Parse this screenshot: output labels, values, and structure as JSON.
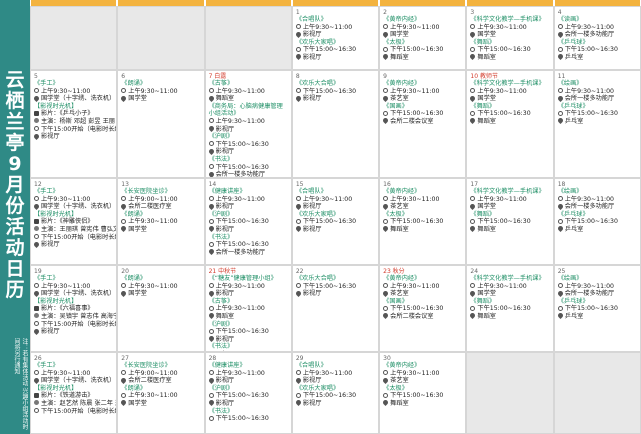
{
  "sidebar": {
    "title": "云栖兰亭9月份活动日历",
    "note": "注：若有集体活动 兴趣小组活动时间将另行通知"
  },
  "cells": [
    {
      "date": "",
      "events": [],
      "empty": true
    },
    {
      "date": "",
      "events": [],
      "empty": true
    },
    {
      "date": "",
      "events": [],
      "empty": true
    },
    {
      "date": "1",
      "events": [
        {
          "title": "《合唱队》",
          "rows": [
            {
              "icon": "clock",
              "text": "上午9:30~11:00"
            },
            {
              "icon": "pin",
              "text": "影视厅"
            }
          ]
        },
        {
          "title": "《欢乐大家唱》",
          "rows": [
            {
              "icon": "clock",
              "text": "下午15:00~16:30"
            },
            {
              "icon": "pin",
              "text": "影视厅"
            }
          ]
        }
      ]
    },
    {
      "date": "2",
      "events": [
        {
          "title": "《黄帝内经》",
          "rows": [
            {
              "icon": "clock",
              "text": "上午9:30~11:00"
            },
            {
              "icon": "pin",
              "text": "国学堂"
            }
          ]
        },
        {
          "title": "《太极》",
          "rows": [
            {
              "icon": "clock",
              "text": "下午15:00~16:30"
            },
            {
              "icon": "pin",
              "text": "舞蹈室"
            }
          ]
        }
      ]
    },
    {
      "date": "3",
      "events": [
        {
          "title": "《科学文化教学—手机课》",
          "rows": [
            {
              "icon": "clock",
              "text": "上午9:30~11:00"
            },
            {
              "icon": "pin",
              "text": "国学堂"
            }
          ]
        },
        {
          "title": "《舞蹈》",
          "rows": [
            {
              "icon": "clock",
              "text": "下午15:00~16:30"
            },
            {
              "icon": "pin",
              "text": "舞蹈室"
            }
          ]
        }
      ]
    },
    {
      "date": "4",
      "events": [
        {
          "title": "《读画》",
          "rows": [
            {
              "icon": "clock",
              "text": "上午9:30~11:00"
            },
            {
              "icon": "pin",
              "text": "会所一楼多功能厅"
            }
          ]
        },
        {
          "title": "《乒乓球》",
          "rows": [
            {
              "icon": "clock",
              "text": "下午15:00~16:30"
            },
            {
              "icon": "pin",
              "text": "乒乓室"
            }
          ]
        }
      ]
    },
    {
      "date": "5",
      "events": [
        {
          "title": "《手工》",
          "rows": [
            {
              "icon": "clock",
              "text": "上午9:30~11:00"
            },
            {
              "icon": "pin",
              "text": "国学堂（十字绣、洗衣机）"
            }
          ]
        },
        {
          "title": "【影视时光机】",
          "rows": [
            {
              "icon": "film",
              "text": "影片：《乒乓小子》"
            },
            {
              "icon": "person",
              "text": "主演：杨斯 邓超 彭昱 王丽"
            },
            {
              "icon": "clock",
              "text": "下午15:00开始（电影时长约120分钟）"
            },
            {
              "icon": "pin",
              "text": "影视厅"
            }
          ]
        }
      ]
    },
    {
      "date": "6",
      "events": [
        {
          "title": "《朗诵》",
          "rows": [
            {
              "icon": "clock",
              "text": "上午9:30~11:00"
            },
            {
              "icon": "pin",
              "text": "国学堂"
            }
          ]
        }
      ]
    },
    {
      "date": "7",
      "red": "白露",
      "events": [
        {
          "title": "《古筝》",
          "rows": [
            {
              "icon": "clock",
              "text": "上午9:30~11:00"
            },
            {
              "icon": "pin",
              "text": "舞蹈室"
            }
          ]
        },
        {
          "title": "《商务局：心脑病健康管理小组活动》",
          "rows": [
            {
              "icon": "clock",
              "text": "上午9:30~11:00"
            },
            {
              "icon": "pin",
              "text": "影视厅"
            }
          ]
        },
        {
          "title": "《沪剧》",
          "rows": [
            {
              "icon": "clock",
              "text": "下午15:00~16:30"
            },
            {
              "icon": "pin",
              "text": "影视厅"
            }
          ]
        },
        {
          "title": "《书法》",
          "rows": [
            {
              "icon": "clock",
              "text": "下午15:00~16:30"
            },
            {
              "icon": "pin",
              "text": "会所一楼多功能厅"
            }
          ]
        }
      ]
    },
    {
      "date": "8",
      "events": [
        {
          "title": "《欢乐大合唱》",
          "rows": [
            {
              "icon": "clock",
              "text": "下午15:00~16:30"
            },
            {
              "icon": "pin",
              "text": "影视厅"
            }
          ]
        }
      ]
    },
    {
      "date": "9",
      "events": [
        {
          "title": "《黄帝内经》",
          "rows": [
            {
              "icon": "clock",
              "text": "上午9:30~11:00"
            },
            {
              "icon": "pin",
              "text": "茶艺室"
            }
          ]
        },
        {
          "title": "《国画》",
          "rows": [
            {
              "icon": "clock",
              "text": "下午15:00~16:30"
            },
            {
              "icon": "pin",
              "text": "会所二楼会议室"
            }
          ]
        }
      ]
    },
    {
      "date": "10",
      "red": "教师节",
      "events": [
        {
          "title": "《科学文化教学—手机课》",
          "rows": [
            {
              "icon": "clock",
              "text": "上午9:30~11:00"
            },
            {
              "icon": "pin",
              "text": "国学堂"
            }
          ]
        },
        {
          "title": "《舞蹈》",
          "rows": [
            {
              "icon": "clock",
              "text": "下午15:00~16:30"
            },
            {
              "icon": "pin",
              "text": "舞蹈室"
            }
          ]
        }
      ]
    },
    {
      "date": "11",
      "events": [
        {
          "title": "《绘画》",
          "rows": [
            {
              "icon": "clock",
              "text": "上午9:30~11:00"
            },
            {
              "icon": "pin",
              "text": "会所一楼多功能厅"
            }
          ]
        },
        {
          "title": "《乒乓球》",
          "rows": [
            {
              "icon": "clock",
              "text": "下午15:00~16:30"
            },
            {
              "icon": "pin",
              "text": "乒乓室"
            }
          ]
        }
      ]
    },
    {
      "date": "12",
      "events": [
        {
          "title": "《手工》",
          "rows": [
            {
              "icon": "clock",
              "text": "上午9:30~11:00"
            },
            {
              "icon": "pin",
              "text": "国学堂（十字绣、洗衣机）"
            }
          ]
        },
        {
          "title": "【影视时光机】",
          "rows": [
            {
              "icon": "film",
              "text": "影片：《神雕侠侣》"
            },
            {
              "icon": "person",
              "text": "主演：王丽琪 曾宪伟 曹弘文 戚丽"
            },
            {
              "icon": "clock",
              "text": "下午15:00开始（电影时长约120分钟）"
            },
            {
              "icon": "pin",
              "text": "影视厅"
            }
          ]
        }
      ]
    },
    {
      "date": "13",
      "events": [
        {
          "title": "《长安医院坐诊》",
          "rows": [
            {
              "icon": "clock",
              "text": "上午9:00~11:00"
            },
            {
              "icon": "pin",
              "text": "会所二楼医疗室"
            }
          ]
        },
        {
          "title": "《朗诵》",
          "rows": [
            {
              "icon": "clock",
              "text": "上午9:30~11:00"
            },
            {
              "icon": "pin",
              "text": "国学堂"
            }
          ]
        }
      ]
    },
    {
      "date": "14",
      "events": [
        {
          "title": "《健康讲座》",
          "rows": [
            {
              "icon": "clock",
              "text": "上午9:30~11:00"
            },
            {
              "icon": "pin",
              "text": "影视厅"
            }
          ]
        },
        {
          "title": "《沪剧》",
          "rows": [
            {
              "icon": "clock",
              "text": "下午15:00~16:30"
            },
            {
              "icon": "pin",
              "text": "影视厅"
            }
          ]
        },
        {
          "title": "《书法》",
          "rows": [
            {
              "icon": "clock",
              "text": "下午15:00~16:30"
            },
            {
              "icon": "pin",
              "text": "会所一楼多功能厅"
            }
          ]
        }
      ]
    },
    {
      "date": "15",
      "events": [
        {
          "title": "《合唱队》",
          "rows": [
            {
              "icon": "clock",
              "text": "上午9:30~11:00"
            },
            {
              "icon": "pin",
              "text": "影视厅"
            }
          ]
        },
        {
          "title": "《欢乐大家唱》",
          "rows": [
            {
              "icon": "clock",
              "text": "下午15:00~16:30"
            },
            {
              "icon": "pin",
              "text": "影视厅"
            }
          ]
        }
      ]
    },
    {
      "date": "16",
      "events": [
        {
          "title": "《黄帝内经》",
          "rows": [
            {
              "icon": "clock",
              "text": "上午9:30~11:00"
            },
            {
              "icon": "pin",
              "text": "茶艺室"
            }
          ]
        },
        {
          "title": "《太极》",
          "rows": [
            {
              "icon": "clock",
              "text": "下午15:00~16:30"
            },
            {
              "icon": "pin",
              "text": "舞蹈室"
            }
          ]
        }
      ]
    },
    {
      "date": "17",
      "events": [
        {
          "title": "《科学文化教学—手机课》",
          "rows": [
            {
              "icon": "clock",
              "text": "上午9:30~11:00"
            },
            {
              "icon": "pin",
              "text": "国学堂"
            }
          ]
        },
        {
          "title": "《舞蹈》",
          "rows": [
            {
              "icon": "clock",
              "text": "下午15:00~16:30"
            },
            {
              "icon": "pin",
              "text": "舞蹈室"
            }
          ]
        }
      ]
    },
    {
      "date": "18",
      "events": [
        {
          "title": "《绘画》",
          "rows": [
            {
              "icon": "clock",
              "text": "上午9:30~11:00"
            },
            {
              "icon": "pin",
              "text": "会所一楼多功能厅"
            }
          ]
        },
        {
          "title": "《乒乓球》",
          "rows": [
            {
              "icon": "clock",
              "text": "下午15:00~16:30"
            },
            {
              "icon": "pin",
              "text": "乒乓室"
            }
          ]
        }
      ]
    },
    {
      "date": "19",
      "events": [
        {
          "title": "《手工》",
          "rows": [
            {
              "icon": "clock",
              "text": "上午9:30~11:00"
            },
            {
              "icon": "pin",
              "text": "国学堂（十字绣、洗衣机）"
            }
          ]
        },
        {
          "title": "【影视时光机】",
          "rows": [
            {
              "icon": "film",
              "text": "影片：《六福喜事》"
            },
            {
              "icon": "person",
              "text": "主演：吴镇宇 曾志伟 高海宁 刘中敏"
            },
            {
              "icon": "clock",
              "text": "下午15:00开始（电影时长约100分钟）"
            },
            {
              "icon": "pin",
              "text": "影视厅"
            }
          ]
        }
      ]
    },
    {
      "date": "20",
      "events": [
        {
          "title": "《朗诵》",
          "rows": [
            {
              "icon": "clock",
              "text": "上午9:30~11:00"
            },
            {
              "icon": "pin",
              "text": "国学堂"
            }
          ]
        }
      ]
    },
    {
      "date": "21",
      "red": "中秋节",
      "events": [
        {
          "title": "《“糖友”健康管理小组》",
          "rows": [
            {
              "icon": "clock",
              "text": "上午9:30~11:00"
            },
            {
              "icon": "pin",
              "text": "影视厅"
            }
          ]
        },
        {
          "title": "《古筝》",
          "rows": [
            {
              "icon": "clock",
              "text": "上午9:30~11:00"
            },
            {
              "icon": "pin",
              "text": "舞蹈室"
            }
          ]
        },
        {
          "title": "《沪剧》",
          "rows": [
            {
              "icon": "clock",
              "text": "下午15:00~16:30"
            },
            {
              "icon": "pin",
              "text": "影视厅"
            }
          ]
        },
        {
          "title": "《书法》",
          "rows": [
            {
              "icon": "clock",
              "text": "下午15:00~16:30"
            },
            {
              "icon": "pin",
              "text": "会所一楼多功能厅"
            }
          ]
        }
      ]
    },
    {
      "date": "22",
      "events": [
        {
          "title": "《欢乐大合唱》",
          "rows": [
            {
              "icon": "clock",
              "text": "下午15:00~16:30"
            },
            {
              "icon": "pin",
              "text": "影视厅"
            }
          ]
        }
      ]
    },
    {
      "date": "23",
      "red": "秋分",
      "events": [
        {
          "title": "《黄帝内经》",
          "rows": [
            {
              "icon": "clock",
              "text": "上午9:30~11:00"
            },
            {
              "icon": "pin",
              "text": "茶艺室"
            }
          ]
        },
        {
          "title": "《国画》",
          "rows": [
            {
              "icon": "clock",
              "text": "下午15:00~16:30"
            },
            {
              "icon": "pin",
              "text": "会所二楼会议室"
            }
          ]
        }
      ]
    },
    {
      "date": "24",
      "events": [
        {
          "title": "《科学文化教学—手机课》",
          "rows": [
            {
              "icon": "clock",
              "text": "上午9:30~11:00"
            },
            {
              "icon": "pin",
              "text": "国学堂"
            }
          ]
        },
        {
          "title": "《舞蹈》",
          "rows": [
            {
              "icon": "clock",
              "text": "下午15:00~16:30"
            },
            {
              "icon": "pin",
              "text": "舞蹈室"
            }
          ]
        }
      ]
    },
    {
      "date": "25",
      "events": [
        {
          "title": "《绘画》",
          "rows": [
            {
              "icon": "clock",
              "text": "上午9:30~11:00"
            },
            {
              "icon": "pin",
              "text": "会所一楼多功能厅"
            }
          ]
        },
        {
          "title": "《乒乓球》",
          "rows": [
            {
              "icon": "clock",
              "text": "下午15:00~16:30"
            },
            {
              "icon": "pin",
              "text": "乒乓室"
            }
          ]
        }
      ]
    },
    {
      "date": "26",
      "events": [
        {
          "title": "《手工》",
          "rows": [
            {
              "icon": "clock",
              "text": "上午9:30~11:00"
            },
            {
              "icon": "pin",
              "text": "国学堂（十字绣、洗衣机）"
            }
          ]
        },
        {
          "title": "【影视时光机】",
          "rows": [
            {
              "icon": "film",
              "text": "影片：《铁道游击》"
            },
            {
              "icon": "person",
              "text": "主演：赵艺然 陈晨 张二年 郑宫军"
            },
            {
              "icon": "clock",
              "text": "下午15:00开始（电影时长约120分钟）"
            }
          ]
        }
      ]
    },
    {
      "date": "27",
      "events": [
        {
          "title": "《长安医院坐诊》",
          "rows": [
            {
              "icon": "clock",
              "text": "上午9:00~11:00"
            },
            {
              "icon": "pin",
              "text": "会所二楼医疗室"
            }
          ]
        },
        {
          "title": "《朗诵》",
          "rows": [
            {
              "icon": "clock",
              "text": "上午9:30~11:00"
            },
            {
              "icon": "pin",
              "text": "国学堂"
            }
          ]
        }
      ]
    },
    {
      "date": "28",
      "events": [
        {
          "title": "《健康讲座》",
          "rows": [
            {
              "icon": "clock",
              "text": "上午9:30~11:00"
            },
            {
              "icon": "pin",
              "text": "影视厅"
            }
          ]
        },
        {
          "title": "《沪剧》",
          "rows": [
            {
              "icon": "clock",
              "text": "下午15:00~16:30"
            },
            {
              "icon": "pin",
              "text": "影视厅"
            }
          ]
        },
        {
          "title": "《书法》",
          "rows": [
            {
              "icon": "clock",
              "text": "下午15:00~16:30"
            }
          ]
        }
      ]
    },
    {
      "date": "29",
      "events": [
        {
          "title": "《合唱队》",
          "rows": [
            {
              "icon": "clock",
              "text": "上午9:30~11:00"
            },
            {
              "icon": "pin",
              "text": "影视厅"
            }
          ]
        },
        {
          "title": "《欢乐大家唱》",
          "rows": [
            {
              "icon": "clock",
              "text": "下午15:00~16:30"
            },
            {
              "icon": "pin",
              "text": "影视厅"
            }
          ]
        }
      ]
    },
    {
      "date": "30",
      "events": [
        {
          "title": "《黄帝内经》",
          "rows": [
            {
              "icon": "clock",
              "text": "上午9:30~11:00"
            },
            {
              "icon": "pin",
              "text": "茶艺室"
            }
          ]
        },
        {
          "title": "《太极》",
          "rows": [
            {
              "icon": "clock",
              "text": "下午15:00~16:30"
            },
            {
              "icon": "pin",
              "text": "舞蹈室"
            }
          ]
        }
      ]
    },
    {
      "date": "",
      "events": [],
      "empty": true
    },
    {
      "date": "",
      "events": [],
      "empty": true
    }
  ]
}
